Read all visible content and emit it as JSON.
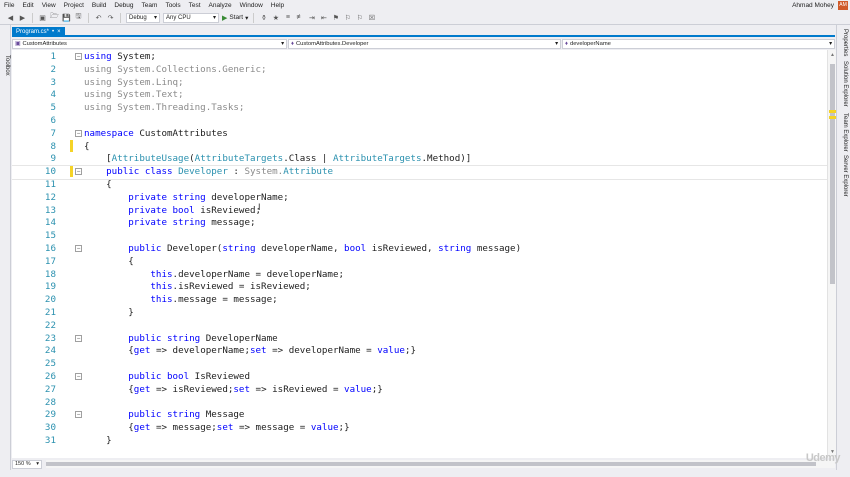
{
  "menu": [
    "File",
    "Edit",
    "View",
    "Project",
    "Build",
    "Debug",
    "Team",
    "Tools",
    "Test",
    "Analyze",
    "Window",
    "Help"
  ],
  "user": {
    "name": "Ahmad Mohey",
    "initials": "AM"
  },
  "toolbar": {
    "config": "Debug",
    "platform": "Any CPU",
    "start_label": "Start"
  },
  "left_dock": {
    "label": "Toolbox"
  },
  "right_dock": [
    "Properties",
    "Solution Explorer",
    "Team Explorer",
    "Server Explorer"
  ],
  "tab": {
    "label": "Program.cs*",
    "close": "×"
  },
  "nav": {
    "project": "CustomAttributes",
    "type": "CustomAttributes.Developer",
    "member": "developerName"
  },
  "zoom": "150 %",
  "watermark": "Udemy",
  "colors": {
    "accent": "#007acc",
    "keyword": "#0000ff",
    "type": "#2b91af",
    "grey": "#8a8a8a",
    "modified": "#f5d327"
  },
  "code_lines": [
    {
      "n": "1",
      "t": [
        [
          "kw",
          "using"
        ],
        [
          "pl",
          " System;"
        ]
      ]
    },
    {
      "n": "2",
      "t": [
        [
          "gy",
          "using System.Collections.Generic;"
        ]
      ]
    },
    {
      "n": "3",
      "t": [
        [
          "gy",
          "using System.Linq;"
        ]
      ]
    },
    {
      "n": "4",
      "t": [
        [
          "gy",
          "using System.Text;"
        ]
      ]
    },
    {
      "n": "5",
      "t": [
        [
          "gy",
          "using System.Threading.Tasks;"
        ]
      ]
    },
    {
      "n": "6",
      "t": []
    },
    {
      "n": "7",
      "t": [
        [
          "kw",
          "namespace"
        ],
        [
          "pl",
          " CustomAttributes"
        ]
      ]
    },
    {
      "n": "8",
      "t": [
        [
          "pl",
          "{"
        ]
      ]
    },
    {
      "n": "9",
      "t": [
        [
          "pl",
          "    ["
        ],
        [
          "ty",
          "AttributeUsage"
        ],
        [
          "pl",
          "("
        ],
        [
          "ty",
          "AttributeTargets"
        ],
        [
          "pl",
          ".Class | "
        ],
        [
          "ty",
          "AttributeTargets"
        ],
        [
          "pl",
          ".Method)]"
        ]
      ]
    },
    {
      "n": "10",
      "t": [
        [
          "pl",
          "    "
        ],
        [
          "kw",
          "public class"
        ],
        [
          "pl",
          " "
        ],
        [
          "ty",
          "Developer"
        ],
        [
          "pl",
          " : "
        ],
        [
          "gy",
          "System."
        ],
        [
          "ty",
          "Attribute"
        ]
      ]
    },
    {
      "n": "11",
      "t": [
        [
          "pl",
          "    {"
        ]
      ]
    },
    {
      "n": "12",
      "t": [
        [
          "pl",
          "        "
        ],
        [
          "kw",
          "private string"
        ],
        [
          "pl",
          " developerName;"
        ]
      ]
    },
    {
      "n": "13",
      "t": [
        [
          "pl",
          "        "
        ],
        [
          "kw",
          "private bool"
        ],
        [
          "pl",
          " isReviewed;"
        ]
      ]
    },
    {
      "n": "14",
      "t": [
        [
          "pl",
          "        "
        ],
        [
          "kw",
          "private string"
        ],
        [
          "pl",
          " message;"
        ]
      ]
    },
    {
      "n": "15",
      "t": []
    },
    {
      "n": "16",
      "t": [
        [
          "pl",
          "        "
        ],
        [
          "kw",
          "public"
        ],
        [
          "pl",
          " Developer("
        ],
        [
          "kw",
          "string"
        ],
        [
          "pl",
          " developerName, "
        ],
        [
          "kw",
          "bool"
        ],
        [
          "pl",
          " isReviewed, "
        ],
        [
          "kw",
          "string"
        ],
        [
          "pl",
          " message)"
        ]
      ]
    },
    {
      "n": "17",
      "t": [
        [
          "pl",
          "        {"
        ]
      ]
    },
    {
      "n": "18",
      "t": [
        [
          "pl",
          "            "
        ],
        [
          "kw",
          "this"
        ],
        [
          "pl",
          ".developerName = developerName;"
        ]
      ]
    },
    {
      "n": "19",
      "t": [
        [
          "pl",
          "            "
        ],
        [
          "kw",
          "this"
        ],
        [
          "pl",
          ".isReviewed = isReviewed;"
        ]
      ]
    },
    {
      "n": "20",
      "t": [
        [
          "pl",
          "            "
        ],
        [
          "kw",
          "this"
        ],
        [
          "pl",
          ".message = message;"
        ]
      ]
    },
    {
      "n": "21",
      "t": [
        [
          "pl",
          "        }"
        ]
      ]
    },
    {
      "n": "22",
      "t": []
    },
    {
      "n": "23",
      "t": [
        [
          "pl",
          "        "
        ],
        [
          "kw",
          "public string"
        ],
        [
          "pl",
          " DeveloperName"
        ]
      ]
    },
    {
      "n": "24",
      "t": [
        [
          "pl",
          "        {"
        ],
        [
          "kw",
          "get"
        ],
        [
          "pl",
          " => developerName;"
        ],
        [
          "kw",
          "set"
        ],
        [
          "pl",
          " => developerName = "
        ],
        [
          "kw",
          "value"
        ],
        [
          "pl",
          ";}"
        ]
      ]
    },
    {
      "n": "25",
      "t": []
    },
    {
      "n": "26",
      "t": [
        [
          "pl",
          "        "
        ],
        [
          "kw",
          "public bool"
        ],
        [
          "pl",
          " IsReviewed"
        ]
      ]
    },
    {
      "n": "27",
      "t": [
        [
          "pl",
          "        {"
        ],
        [
          "kw",
          "get"
        ],
        [
          "pl",
          " => isReviewed;"
        ],
        [
          "kw",
          "set"
        ],
        [
          "pl",
          " => isReviewed = "
        ],
        [
          "kw",
          "value"
        ],
        [
          "pl",
          ";}"
        ]
      ]
    },
    {
      "n": "28",
      "t": []
    },
    {
      "n": "29",
      "t": [
        [
          "pl",
          "        "
        ],
        [
          "kw",
          "public string"
        ],
        [
          "pl",
          " Message"
        ]
      ]
    },
    {
      "n": "30",
      "t": [
        [
          "pl",
          "        {"
        ],
        [
          "kw",
          "get"
        ],
        [
          "pl",
          " => message;"
        ],
        [
          "kw",
          "set"
        ],
        [
          "pl",
          " => message = "
        ],
        [
          "kw",
          "value"
        ],
        [
          "pl",
          ";}"
        ]
      ]
    },
    {
      "n": "31",
      "t": [
        [
          "pl",
          "    }"
        ]
      ]
    }
  ]
}
